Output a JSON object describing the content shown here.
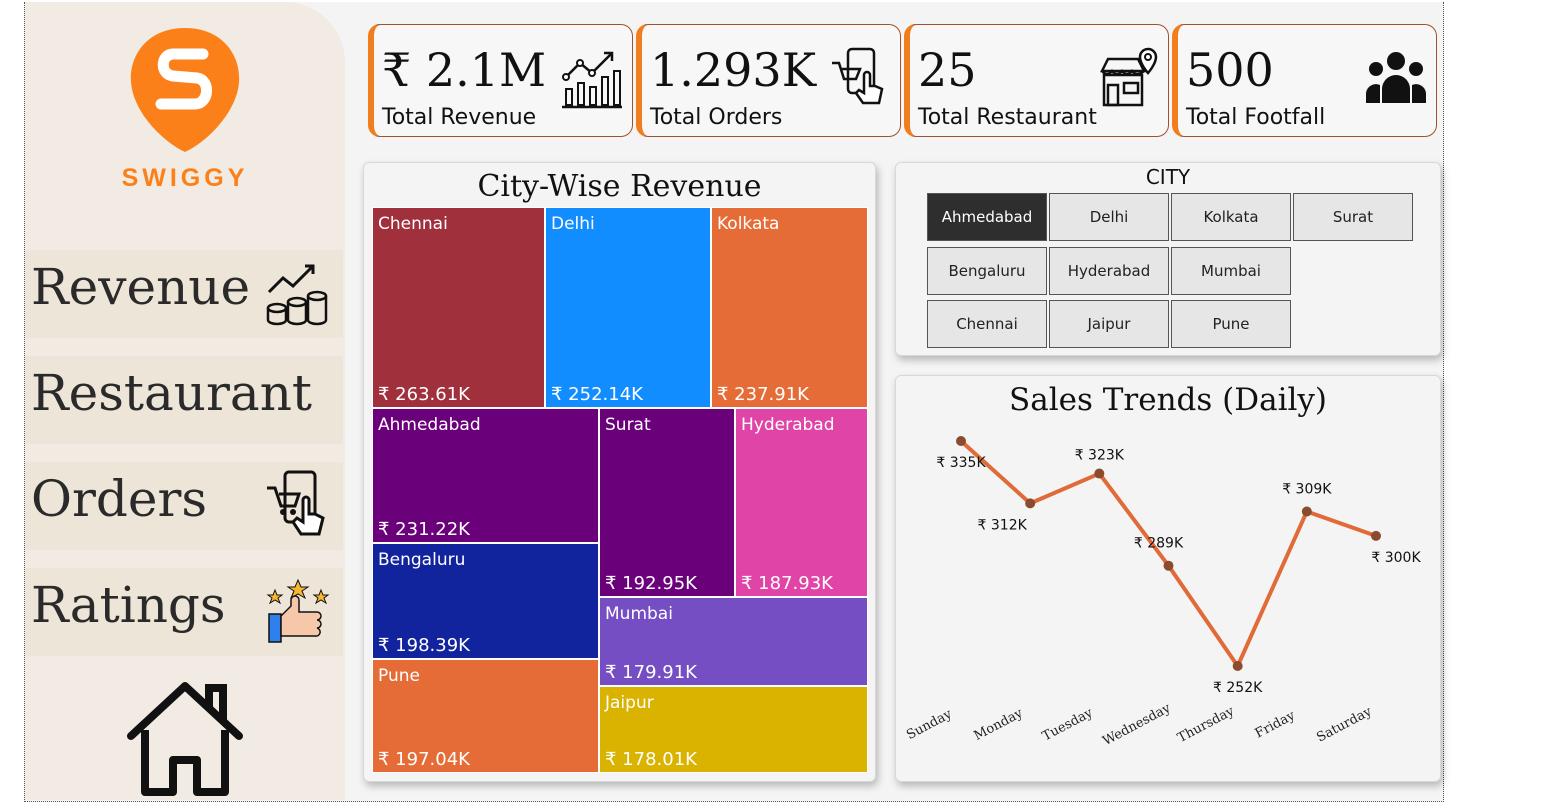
{
  "brand": {
    "name": "SWIGGY",
    "color": "#fc8019"
  },
  "nav": [
    {
      "label": "Revenue",
      "icon": "revenue-coins-icon"
    },
    {
      "label": "Restaurant",
      "icon": ""
    },
    {
      "label": "Orders",
      "icon": "phone-cart-icon"
    },
    {
      "label": "Ratings",
      "icon": "stars-thumbs-up-icon"
    }
  ],
  "home_icon": "home-icon",
  "kpis": [
    {
      "value": "₹ 2.1M",
      "label": "Total Revenue",
      "icon": "growth-chart-icon"
    },
    {
      "value": "1.293K",
      "label": "Total Orders",
      "icon": "phone-cart-icon"
    },
    {
      "value": "25",
      "label": "Total Restaurant",
      "icon": "store-location-icon"
    },
    {
      "value": "500",
      "label": "Total Footfall",
      "icon": "people-group-icon"
    }
  ],
  "treemap": {
    "title": "City-Wise Revenue",
    "tiles": [
      {
        "name": "Chennai",
        "value": "₹ 263.61K",
        "color": "#a1303d"
      },
      {
        "name": "Delhi",
        "value": "₹ 252.14K",
        "color": "#118dff"
      },
      {
        "name": "Kolkata",
        "value": "₹ 237.91K",
        "color": "#e66c37"
      },
      {
        "name": "Ahmedabad",
        "value": "₹ 231.22K",
        "color": "#6b007b"
      },
      {
        "name": "Surat",
        "value": "₹ 192.95K",
        "color": "#6b007b"
      },
      {
        "name": "Hyderabad",
        "value": "₹ 187.93K",
        "color": "#e044a7"
      },
      {
        "name": "Bengaluru",
        "value": "₹ 198.39K",
        "color": "#12239e"
      },
      {
        "name": "Mumbai",
        "value": "₹ 179.91K",
        "color": "#744ec2"
      },
      {
        "name": "Pune",
        "value": "₹ 197.04K",
        "color": "#e66c37"
      },
      {
        "name": "Jaipur",
        "value": "₹ 178.01K",
        "color": "#d9b300"
      }
    ]
  },
  "slicer": {
    "title": "CITY",
    "options": [
      "Ahmedabad",
      "Delhi",
      "Kolkata",
      "Surat",
      "Bengaluru",
      "Hyderabad",
      "Mumbai",
      "Chennai",
      "Jaipur",
      "Pune"
    ],
    "selected": "Ahmedabad"
  },
  "chart_data": {
    "type": "line",
    "title": "Sales Trends (Daily)",
    "categories": [
      "Sunday",
      "Monday",
      "Tuesday",
      "Wednesday",
      "Thursday",
      "Friday",
      "Saturday"
    ],
    "values": [
      335,
      312,
      323,
      289,
      252,
      309,
      300
    ],
    "labels": [
      "₹ 335K",
      "₹ 312K",
      "₹ 323K",
      "₹ 289K",
      "₹ 252K",
      "₹ 309K",
      "₹ 300K"
    ],
    "line_color": "#e06b38",
    "marker_color": "#8a4b2f",
    "grid": false,
    "legend": "none"
  }
}
